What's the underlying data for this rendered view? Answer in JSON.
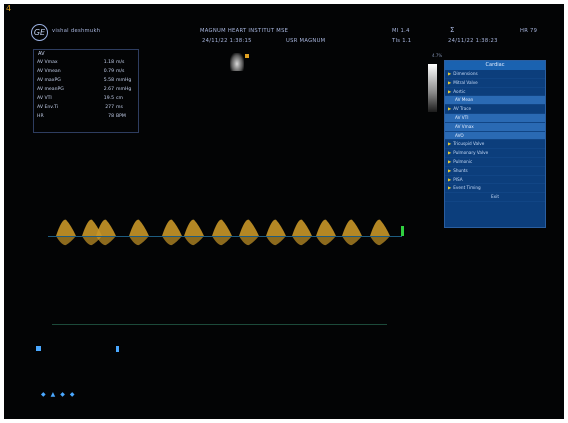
{
  "corner": "4",
  "logo": "GE",
  "header": {
    "operator": "vishal deshmukh",
    "hospital": "MAGNUM HEART INSTITUT MSE",
    "exam_datetime": "24/11/22 1:38:15",
    "user": "USR MAGNUM",
    "mi": "MI 1.4",
    "tis": "TIs 1.1",
    "probe_icon": "Σ",
    "hr_top": "HR 79",
    "datetime": "24/11/22 1:38:23"
  },
  "grey_label": "4.7%",
  "measurements": {
    "title": "AV",
    "rows": [
      {
        "label": "AV Vmax",
        "value": "1.18",
        "unit": "m/s"
      },
      {
        "label": "AV Vmean",
        "value": "0.79",
        "unit": "m/s"
      },
      {
        "label": "AV maxPG",
        "value": "5.58",
        "unit": "mmHg"
      },
      {
        "label": "AV meanPG",
        "value": "2.67",
        "unit": "mmHg"
      },
      {
        "label": "AV VTI",
        "value": "19.5",
        "unit": "cm"
      },
      {
        "label": "AV Env.Ti",
        "value": "277",
        "unit": "ms"
      },
      {
        "label": "HR",
        "value": "78",
        "unit": "BPM"
      }
    ]
  },
  "menu": {
    "title": "Cardiac",
    "items": [
      {
        "label": "Dimensions",
        "sub": false,
        "arrow": true
      },
      {
        "label": "Mitral Valve",
        "sub": false,
        "arrow": true
      },
      {
        "label": "Aortic",
        "sub": false,
        "arrow": true
      },
      {
        "label": "AV Mean",
        "sub": true,
        "arrow": false
      },
      {
        "label": "AV Trace",
        "sub": false,
        "arrow": true
      },
      {
        "label": "AV VTI",
        "sub": true,
        "arrow": false
      },
      {
        "label": "AV Vmax",
        "sub": true,
        "arrow": false
      },
      {
        "label": "AVO",
        "sub": true,
        "arrow": false
      },
      {
        "label": "Tricuspid Valve",
        "sub": false,
        "arrow": true
      },
      {
        "label": "Pulmonary Valve",
        "sub": false,
        "arrow": true
      },
      {
        "label": "Pulmonic",
        "sub": false,
        "arrow": true
      },
      {
        "label": "Shunts",
        "sub": false,
        "arrow": true
      },
      {
        "label": "PISA",
        "sub": false,
        "arrow": true
      },
      {
        "label": "Event Timing",
        "sub": false,
        "arrow": true
      }
    ],
    "close": "Exit"
  },
  "colors": {
    "accent": "#4aa8ff",
    "menu_bg": "#0c3e7c",
    "doppler": "#c89628"
  }
}
